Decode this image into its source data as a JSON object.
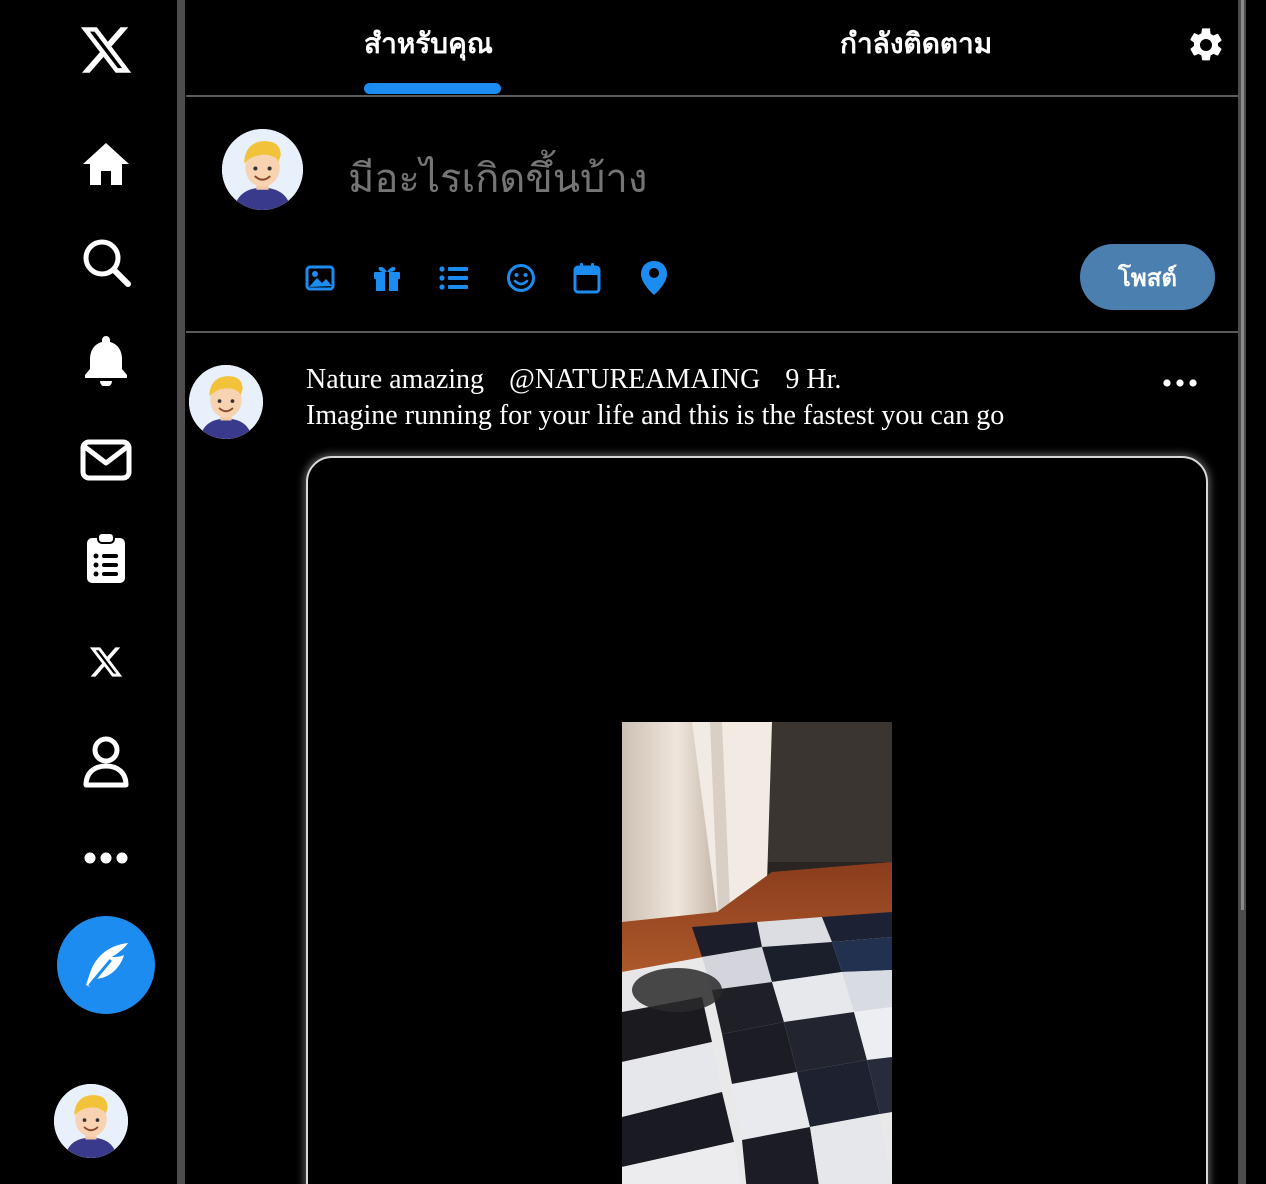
{
  "sidebar": {
    "logo": "x-logo-icon",
    "items": [
      {
        "name": "home",
        "icon": "home-icon"
      },
      {
        "name": "explore",
        "icon": "search-icon"
      },
      {
        "name": "notifications",
        "icon": "bell-icon"
      },
      {
        "name": "messages",
        "icon": "envelope-icon"
      },
      {
        "name": "lists",
        "icon": "clipboard-list-icon"
      },
      {
        "name": "premium",
        "icon": "x-logo-icon"
      },
      {
        "name": "profile",
        "icon": "user-icon"
      },
      {
        "name": "more",
        "icon": "ellipsis-icon"
      }
    ],
    "compose_icon": "feather-icon",
    "avatar": "user-avatar"
  },
  "tabs": {
    "for_you": "สำหรับคุณ",
    "following": "กำลังติดตาม",
    "active": "for_you",
    "settings_icon": "gear-icon"
  },
  "composer": {
    "placeholder": "มีอะไรเกิดขึ้นบ้าง",
    "tools": [
      "image-icon",
      "gift-icon",
      "list-icon",
      "smile-icon",
      "calendar-icon",
      "location-pin-icon"
    ],
    "post_label": "โพสต์"
  },
  "tweet": {
    "name": "Nature amazing",
    "handle": "@NATUREAMAING",
    "time": "9 Hr.",
    "text": "Imagine running for your life and this is the fastest you can go",
    "more_icon": "ellipsis-icon"
  },
  "colors": {
    "background": "#000000",
    "accent": "#1d8cf0",
    "post_button": "#4a7fb0",
    "placeholder": "#6f6f6f",
    "divider": "#5a5a5a"
  }
}
